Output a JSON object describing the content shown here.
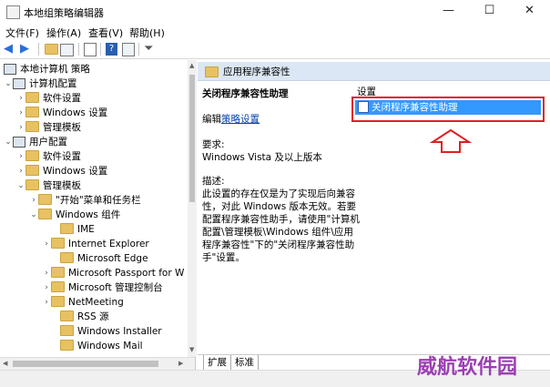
{
  "window": {
    "title": "本地组策略编辑器",
    "minimize": "—",
    "maximize": "☐",
    "close": "✕"
  },
  "menu": [
    "文件(F)",
    "操作(A)",
    "查看(V)",
    "帮助(H)"
  ],
  "tree": {
    "root": "本地计算机 策略",
    "computer_config": "计算机配置",
    "software_settings_1": "软件设置",
    "windows_settings_1": "Windows 设置",
    "admin_templates_1": "管理模板",
    "user_config": "用户配置",
    "software_settings_2": "软件设置",
    "windows_settings_2": "Windows 设置",
    "admin_templates_2": "管理模板",
    "start_menu": "\"开始\"菜单和任务栏",
    "windows_components": "Windows 组件",
    "ime": "IME",
    "ie": "Internet Explorer",
    "edge": "Microsoft Edge",
    "passport": "Microsoft Passport for W",
    "mmc": "Microsoft 管理控制台",
    "netmeeting": "NetMeeting",
    "rss": "RSS 源",
    "installer": "Windows Installer",
    "mail": "Windows Mail"
  },
  "right": {
    "header": "应用程序兼容性",
    "policy_title": "关闭程序兼容性助理",
    "edit_prefix": "编辑",
    "edit_link": "策略设置",
    "req_label": "要求:",
    "req_value": "Windows Vista 及以上版本",
    "desc_label": "描述:",
    "desc_lines": [
      "此设置的存在仅是为了实现后向兼容",
      "性，对此 Windows 版本无效。若要",
      "配置程序兼容性助手，请使用\"计算机",
      "配置\\管理模板\\Windows 组件\\应用",
      "程序兼容性\"下的\"关闭程序兼容性助",
      "手\"设置。"
    ],
    "settings_col": "设置",
    "selected_item": "关闭程序兼容性助理"
  },
  "tabs": [
    "扩展",
    "标准"
  ],
  "watermark": "威航软件园",
  "colors": {
    "selection": "#3399ff",
    "highlight_box": "#e02020",
    "arrow": "#e02020",
    "header_bg": "#dbe7f4"
  }
}
